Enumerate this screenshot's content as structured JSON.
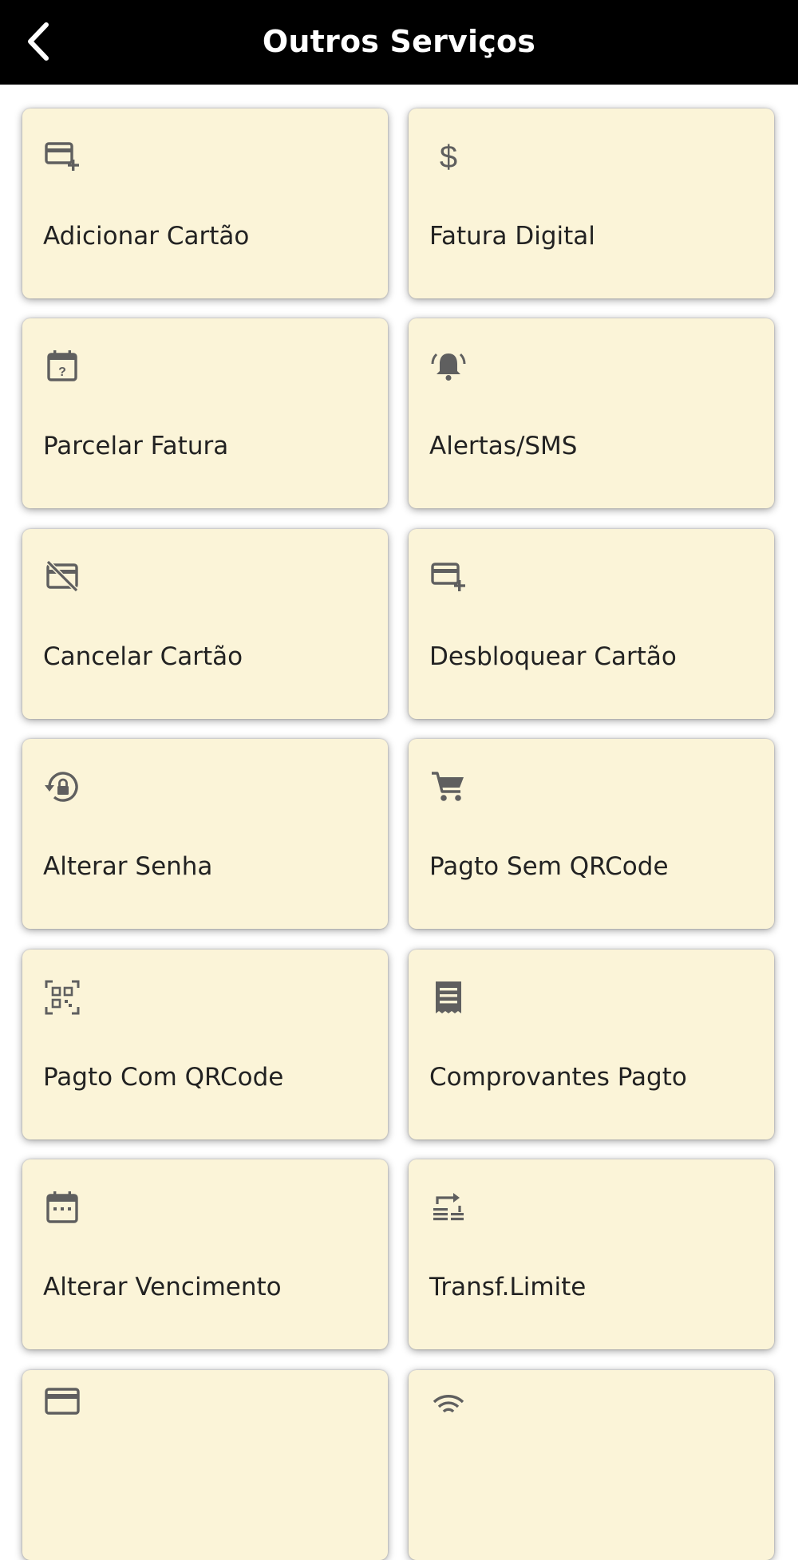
{
  "header": {
    "title": "Outros Serviços",
    "back_icon": "chevron-left-icon"
  },
  "colors": {
    "header_bg": "#000000",
    "header_text": "#ffffff",
    "card_bg": "#fbf4d8",
    "icon_color": "#5f5f5f",
    "label_color": "#222222"
  },
  "services": [
    {
      "label": "Adicionar Cartão",
      "icon": "add-card-icon"
    },
    {
      "label": "Fatura Digital",
      "icon": "dollar-icon"
    },
    {
      "label": "Parcelar Fatura",
      "icon": "calendar-question-icon"
    },
    {
      "label": "Alertas/SMS",
      "icon": "bell-ringing-icon"
    },
    {
      "label": "Cancelar Cartão",
      "icon": "card-off-icon"
    },
    {
      "label": "Desbloquear Cartão",
      "icon": "add-card-icon"
    },
    {
      "label": "Alterar Senha",
      "icon": "lock-reset-icon"
    },
    {
      "label": "Pagto Sem QRCode",
      "icon": "cart-icon"
    },
    {
      "label": "Pagto Com QRCode",
      "icon": "qr-scan-icon"
    },
    {
      "label": "Comprovantes Pagto",
      "icon": "receipt-icon"
    },
    {
      "label": "Alterar Vencimento",
      "icon": "calendar-icon"
    },
    {
      "label": "Transf.Limite",
      "icon": "transfer-limit-icon"
    }
  ],
  "partial_services": [
    {
      "icon": "card-icon"
    },
    {
      "icon": "wifi-icon"
    }
  ]
}
